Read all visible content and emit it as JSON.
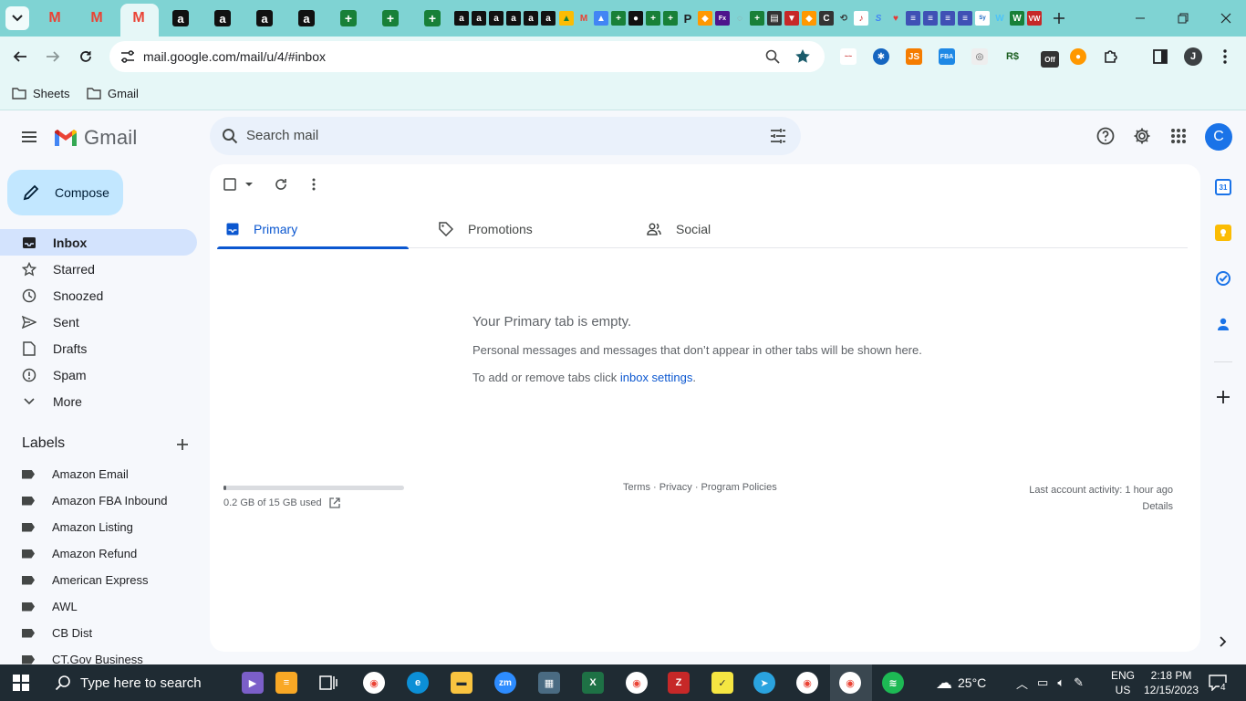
{
  "browser": {
    "url": "mail.google.com/mail/u/4/#inbox",
    "bookmarks": [
      "Sheets",
      "Gmail"
    ]
  },
  "gmail": {
    "app_name": "Gmail",
    "search_placeholder": "Search mail",
    "avatar_letter": "C",
    "compose_label": "Compose",
    "nav": [
      {
        "label": "Inbox",
        "icon": "inbox-icon"
      },
      {
        "label": "Starred",
        "icon": "star-icon"
      },
      {
        "label": "Snoozed",
        "icon": "clock-icon"
      },
      {
        "label": "Sent",
        "icon": "send-icon"
      },
      {
        "label": "Drafts",
        "icon": "draft-icon"
      },
      {
        "label": "Spam",
        "icon": "spam-icon"
      },
      {
        "label": "More",
        "icon": "chevron-down-icon"
      }
    ],
    "labels_title": "Labels",
    "labels": [
      "Amazon Email",
      "Amazon FBA Inbound",
      "Amazon Listing",
      "Amazon Refund",
      "American Express",
      "AWL",
      "CB Dist",
      "CT.Gov Business"
    ],
    "tabs": [
      "Primary",
      "Promotions",
      "Social"
    ],
    "empty_title": "Your Primary tab is empty.",
    "empty_line1": "Personal messages and messages that don’t appear in other tabs will be shown here.",
    "empty_line2_prefix": "To add or remove tabs click ",
    "empty_line2_link": "inbox settings",
    "empty_line2_suffix": ".",
    "storage_text": "0.2 GB of 15 GB used",
    "storage_fraction": 0.013,
    "footer_links": "Terms · Privacy · Program Policies",
    "activity_line1": "Last account activity: 1 hour ago",
    "activity_line2": "Details"
  },
  "taskbar": {
    "search_placeholder": "Type here to search",
    "weather": "25°C",
    "lang1": "ENG",
    "lang2": "US",
    "time": "2:18 PM",
    "date": "12/15/2023",
    "notifications": "4"
  },
  "colors": {
    "tabstrip": "#7fd3d3",
    "toolbar": "#e6f7f7",
    "compose": "#c2e7ff",
    "active_nav": "#d3e3fd",
    "accent": "#0b57d0"
  }
}
